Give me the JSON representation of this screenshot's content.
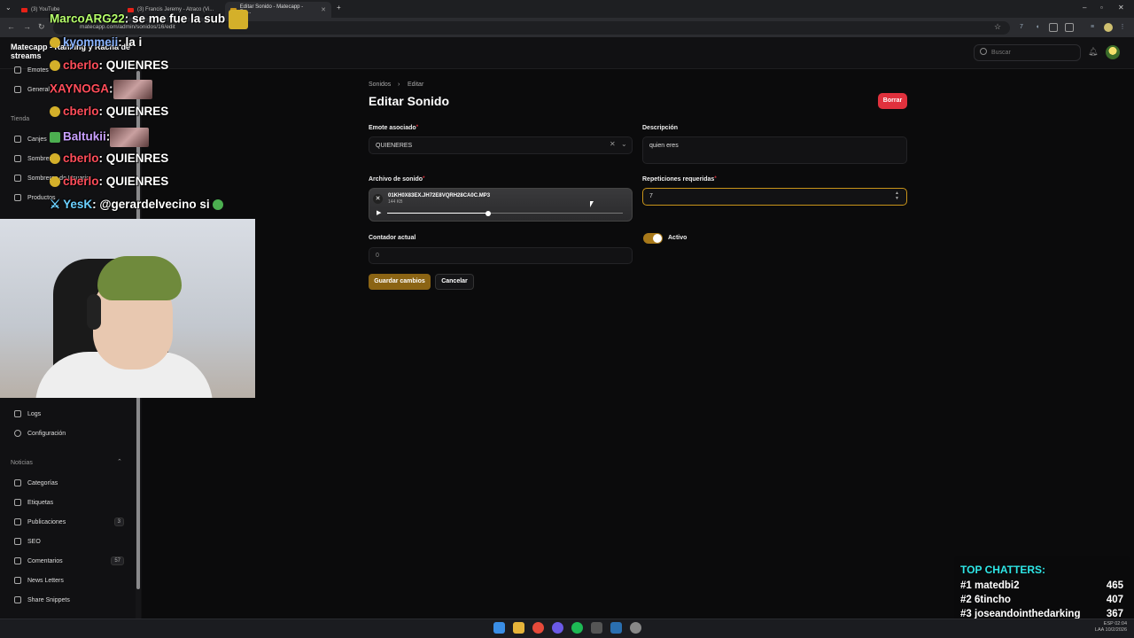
{
  "browser": {
    "tabs": [
      {
        "label": "(3) YouTube"
      },
      {
        "label": "(3) Francis Jeremy - Atraco (Vi..."
      },
      {
        "label": "Editar Sonido - Matecapp - Ra..."
      }
    ],
    "url": "matecapp.com/admin/sonidos/16/edit"
  },
  "header": {
    "brand": "Matecapp - Ranking y Racha de streams",
    "search_placeholder": "Buscar"
  },
  "sidebar": {
    "items_top": [
      {
        "label": "Emotes"
      },
      {
        "label": "General"
      }
    ],
    "section_tienda": "Tienda",
    "tienda_items": [
      {
        "label": "Canjes"
      },
      {
        "label": "Sombreros"
      },
      {
        "label": "Sombreros de Usuario"
      },
      {
        "label": "Productos"
      }
    ],
    "items_mid": [
      {
        "label": "Logs"
      },
      {
        "label": "Configuración"
      }
    ],
    "section_noticias": "Noticias",
    "noticias_items": [
      {
        "label": "Categorías",
        "badge": ""
      },
      {
        "label": "Etiquetas",
        "badge": ""
      },
      {
        "label": "Publicaciones",
        "badge": "3"
      },
      {
        "label": "SEO",
        "badge": ""
      },
      {
        "label": "Comentarios",
        "badge": "57"
      },
      {
        "label": "News Letters",
        "badge": ""
      },
      {
        "label": "Share Snippets",
        "badge": ""
      }
    ]
  },
  "breadcrumb": {
    "parent": "Sonidos",
    "current": "Editar"
  },
  "page": {
    "title": "Editar Sonido",
    "delete_label": "Borrar",
    "emote_label": "Emote asociado",
    "emote_value": "QUIENERES",
    "description_label": "Descripción",
    "description_value": "quien eres",
    "audio_label": "Archivo de sonido",
    "audio_filename": "01KH0X83EX.JH72E8VQRH28CA0C.MP3",
    "audio_size": "144 KB",
    "audio_progress": 0.43,
    "repetitions_label": "Repeticiones requeridas",
    "repetitions_value": "7",
    "counter_label": "Contador actual",
    "counter_value": "0",
    "active_label": "Activo",
    "active": true,
    "save_label": "Guardar cambios",
    "cancel_label": "Cancelar"
  },
  "overlay": {
    "chat": [
      {
        "user": "MarcoARG22",
        "msg": ": se me fue la sub",
        "color": "#b6ff6b"
      },
      {
        "user": "kyommeii",
        "msg": ": la i",
        "color": "#8ab4ff"
      },
      {
        "user": "cberlo",
        "msg": ": QUIENRES",
        "color": "#ff4d5a"
      },
      {
        "user": "XAYNOGA",
        "msg": ":",
        "color": "#ff4d5a"
      },
      {
        "user": "cberlo",
        "msg": ": QUIENRES",
        "color": "#ff4d5a"
      },
      {
        "user": "Baltukii",
        "msg": ":",
        "color": "#c9a0ff"
      },
      {
        "user": "cberlo",
        "msg": ": QUIENRES",
        "color": "#ff4d5a"
      },
      {
        "user": "cberlo",
        "msg": ": QUIENRES",
        "color": "#ff4d5a"
      },
      {
        "user": "YesK",
        "msg": ": @gerardelvecino si",
        "color": "#6bd0ff"
      }
    ],
    "top_chatters_title": "TOP CHATTERS:",
    "top_chatters": [
      {
        "rank": "#1",
        "name": "matedbi2",
        "count": "465"
      },
      {
        "rank": "#2",
        "name": "6tincho",
        "count": "407"
      },
      {
        "rank": "#3",
        "name": "joseandointhedarking",
        "count": "367"
      }
    ]
  },
  "taskbar": {
    "lang": "ESP",
    "lang2": "LAA",
    "time": "02:04",
    "date": "10/2/2026"
  },
  "colors": {
    "accent": "#a8791a",
    "danger": "#e0313d",
    "background": "#0b0b0c"
  }
}
